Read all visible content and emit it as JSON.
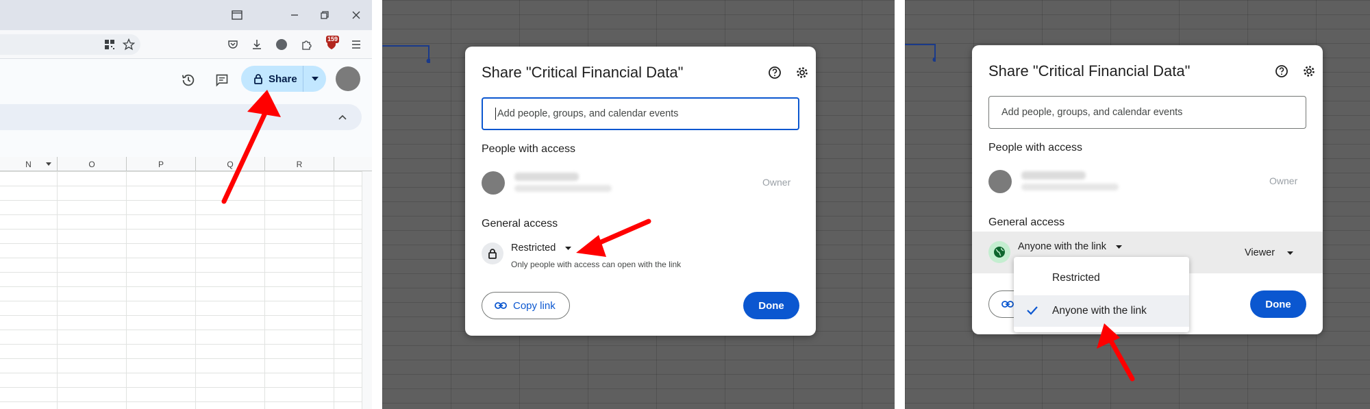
{
  "browser": {
    "badge_count": "159"
  },
  "sheet": {
    "share_label": "Share",
    "columns": [
      "N",
      "O",
      "P",
      "Q",
      "R"
    ]
  },
  "dialog_before": {
    "title": "Share \"Critical Financial Data\"",
    "add_placeholder": "Add people, groups, and calendar events",
    "people_label": "People with access",
    "owner_label": "Owner",
    "general_label": "General access",
    "access_value": "Restricted",
    "access_desc": "Only people with access can open with the link",
    "copy_link": "Copy link",
    "done": "Done"
  },
  "dialog_after": {
    "title": "Share \"Critical Financial Data\"",
    "add_placeholder": "Add people, groups, and calendar events",
    "people_label": "People with access",
    "owner_label": "Owner",
    "general_label": "General access",
    "access_value": "Anyone with the link",
    "role_value": "Viewer",
    "done": "Done",
    "menu_options": [
      "Restricted",
      "Anyone with the link"
    ],
    "selected_option": "Anyone with the link"
  },
  "colors": {
    "accent_blue": "#0b57d0",
    "share_button": "#c2e7ff",
    "annotation_arrow": "#ff0000",
    "globe_bg": "#c4eed0"
  }
}
